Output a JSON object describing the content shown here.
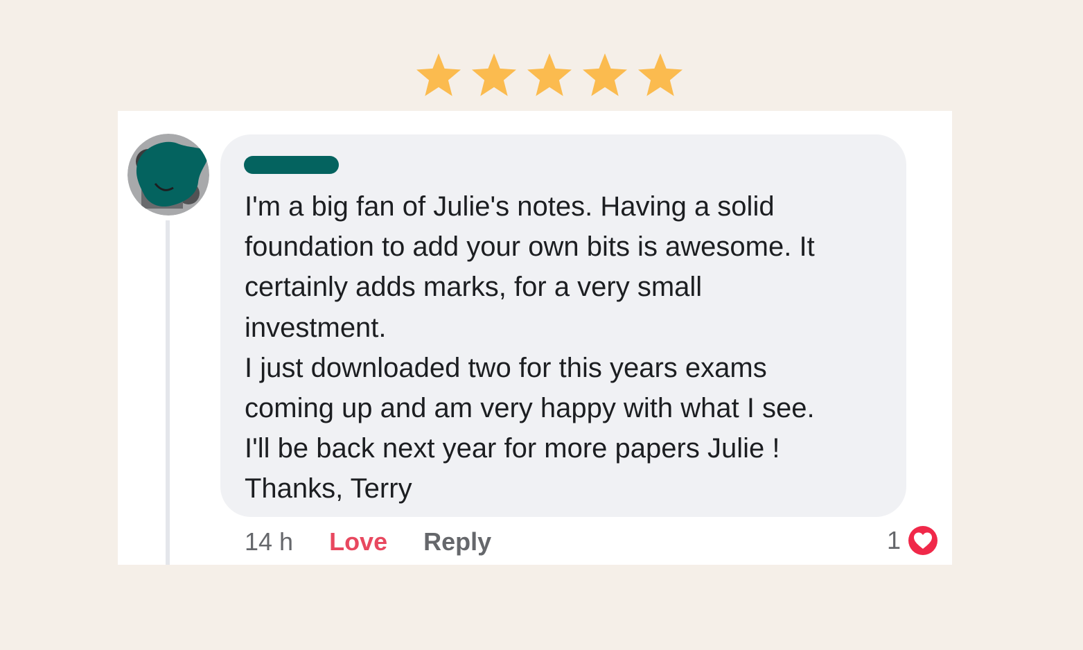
{
  "rating": {
    "stars": 5,
    "max": 5,
    "star_color": "#fbbb4f",
    "star_icon": "star-icon"
  },
  "comment": {
    "author_redaction_color": "#04635f",
    "avatar_icon": "redacted-avatar-icon",
    "lines": [
      "I'm a big fan of Julie's notes. Having a solid",
      "foundation to add your own bits is awesome. It",
      "certainly adds marks, for a very small",
      "investment.",
      "I just downloaded two for this years exams",
      "coming up and am very happy with what I see.",
      "I'll be back next year for more papers Julie !",
      "Thanks, Terry"
    ],
    "time": "14 h",
    "love_label": "Love",
    "reply_label": "Reply",
    "reaction_count": "1",
    "reaction_icon": "heart-reaction-icon",
    "love_color": "#e8485f"
  }
}
